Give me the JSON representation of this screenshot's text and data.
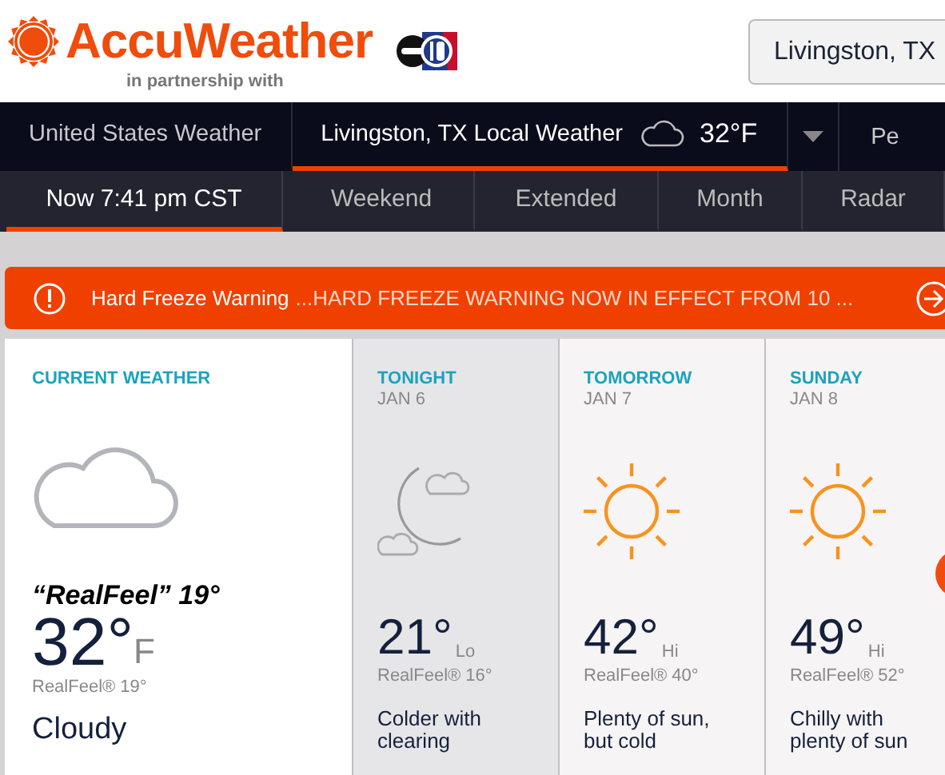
{
  "header": {
    "brand": "AccuWeather",
    "partner_text": "in partnership with",
    "location_button": "Livingston, TX"
  },
  "nav": {
    "items": [
      {
        "label": "United States Weather",
        "selected": false
      },
      {
        "label": "Livingston, TX Local Weather",
        "selected": true,
        "temp": "32°F"
      }
    ],
    "more_label": "Pe"
  },
  "subnav": [
    {
      "label": "Now 7:41 pm CST",
      "selected": true
    },
    {
      "label": "Weekend",
      "selected": false
    },
    {
      "label": "Extended",
      "selected": false
    },
    {
      "label": "Month",
      "selected": false
    },
    {
      "label": "Radar",
      "selected": false
    }
  ],
  "alert": {
    "headline": "Hard Freeze Warning",
    "message": "...HARD FREEZE WARNING NOW IN EFFECT FROM 10 ..."
  },
  "cards": [
    {
      "kind": "current",
      "title": "CURRENT WEATHER",
      "realfeel_big": "“RealFeel” 19°",
      "temp": "32°",
      "unit": "F",
      "realfeel": "RealFeel® 19°",
      "phrase": "Cloudy"
    },
    {
      "kind": "night",
      "title": "TONIGHT",
      "date": "JAN 6",
      "temp": "21°",
      "unit": "Lo",
      "realfeel": "RealFeel® 16°",
      "phrase": "Colder with clearing"
    },
    {
      "kind": "day",
      "title": "TOMORROW",
      "date": "JAN 7",
      "temp": "42°",
      "unit": "Hi",
      "realfeel": "RealFeel® 40°",
      "phrase": "Plenty of sun, but cold"
    },
    {
      "kind": "day",
      "title": "SUNDAY",
      "date": "JAN 8",
      "temp": "49°",
      "unit": "Hi",
      "realfeel": "RealFeel® 52°",
      "phrase": "Chilly with plenty of sun"
    }
  ]
}
